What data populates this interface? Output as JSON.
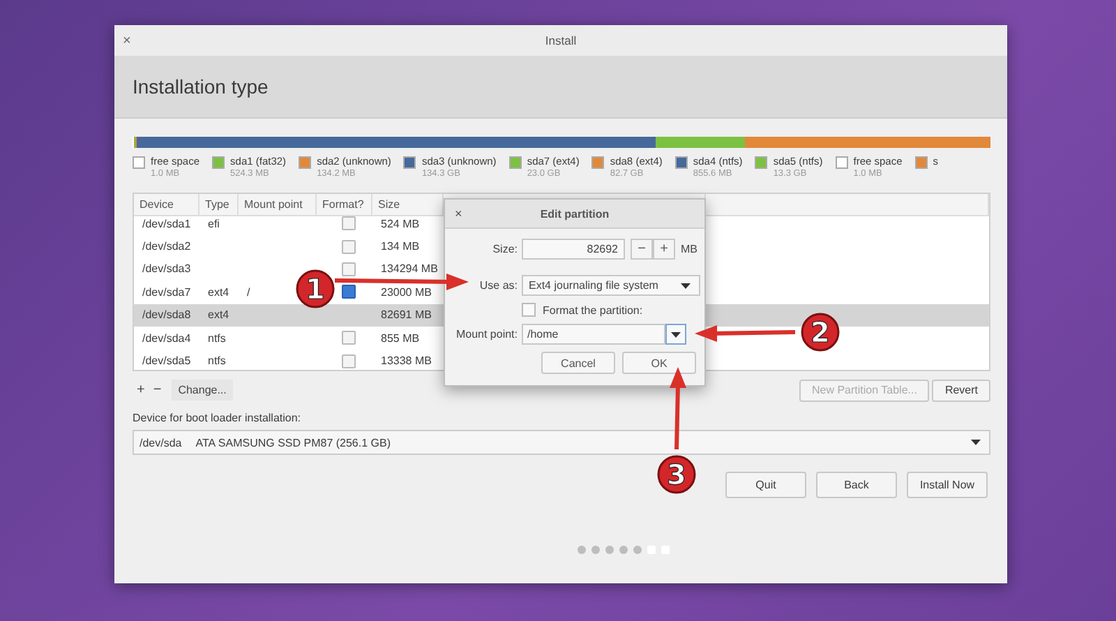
{
  "window": {
    "title": "Install",
    "close": "×"
  },
  "header": {
    "title": "Installation type"
  },
  "partitions": [
    {
      "label": "free space",
      "size": "1.0 MB",
      "color": "#ffffff"
    },
    {
      "label": "sda1 (fat32)",
      "size": "524.3 MB",
      "color": "#7cc142"
    },
    {
      "label": "sda2 (unknown)",
      "size": "134.2 MB",
      "color": "#e2883a"
    },
    {
      "label": "sda3 (unknown)",
      "size": "134.3 GB",
      "color": "#46699b"
    },
    {
      "label": "sda7 (ext4)",
      "size": "23.0 GB",
      "color": "#7cc142"
    },
    {
      "label": "sda8 (ext4)",
      "size": "82.7 GB",
      "color": "#e2883a"
    },
    {
      "label": "sda4 (ntfs)",
      "size": "855.6 MB",
      "color": "#46699b"
    },
    {
      "label": "sda5 (ntfs)",
      "size": "13.3 GB",
      "color": "#7cc142"
    },
    {
      "label": "free space",
      "size": "1.0 MB",
      "color": "#ffffff"
    },
    {
      "label": "s",
      "color": "#e2883a"
    }
  ],
  "table": {
    "columns": [
      "Device",
      "Type",
      "Mount point",
      "Format?",
      "Size"
    ],
    "rows": [
      {
        "device": "/dev/sda1",
        "type": "efi",
        "mount": "",
        "format": false,
        "size": "524 MB",
        "selected": false
      },
      {
        "device": "/dev/sda2",
        "type": "",
        "mount": "",
        "format": false,
        "size": "134 MB",
        "selected": false
      },
      {
        "device": "/dev/sda3",
        "type": "",
        "mount": "",
        "format": false,
        "size": "134294 MB",
        "selected": false
      },
      {
        "device": "/dev/sda7",
        "type": "ext4",
        "mount": "/",
        "format": true,
        "size": "23000 MB",
        "selected": false
      },
      {
        "device": "/dev/sda8",
        "type": "ext4",
        "mount": "",
        "size": "82691 MB",
        "selected": true
      },
      {
        "device": "/dev/sda4",
        "type": "ntfs",
        "mount": "",
        "format": false,
        "size": "855 MB",
        "selected": false
      },
      {
        "device": "/dev/sda5",
        "type": "ntfs",
        "mount": "",
        "format": false,
        "size": "13338 MB",
        "selected": false
      }
    ]
  },
  "table_tools": {
    "add": "+",
    "remove": "−",
    "change": "Change..."
  },
  "new_partition_table": {
    "label": "New Partition Table...",
    "disabled": true
  },
  "revert": "Revert",
  "boot_loader": {
    "label": "Device for boot loader installation:",
    "device": "/dev/sda",
    "description": "ATA SAMSUNG SSD PM87 (256.1 GB)"
  },
  "buttons": [
    "Quit",
    "Back",
    "Install Now"
  ],
  "progress_dots": [
    {
      "done": true
    },
    {
      "done": true
    },
    {
      "done": true
    },
    {
      "done": true
    },
    {
      "done": true
    },
    {
      "done": false
    },
    {
      "done": false
    }
  ],
  "dialog": {
    "title": "Edit partition",
    "close": "×",
    "size_label": "Size:",
    "size_value": "82692",
    "minus": "−",
    "plus": "+",
    "unit": "MB",
    "use_as_label": "Use as:",
    "use_as_value": "Ext4 journaling file system",
    "format_label": "Format the partition:",
    "format_checked": false,
    "mount_label": "Mount point:",
    "mount_value": "/home",
    "buttons": [
      "Cancel",
      "OK"
    ]
  },
  "callouts": [
    {
      "number": "1"
    },
    {
      "number": "2"
    },
    {
      "number": "3"
    }
  ]
}
